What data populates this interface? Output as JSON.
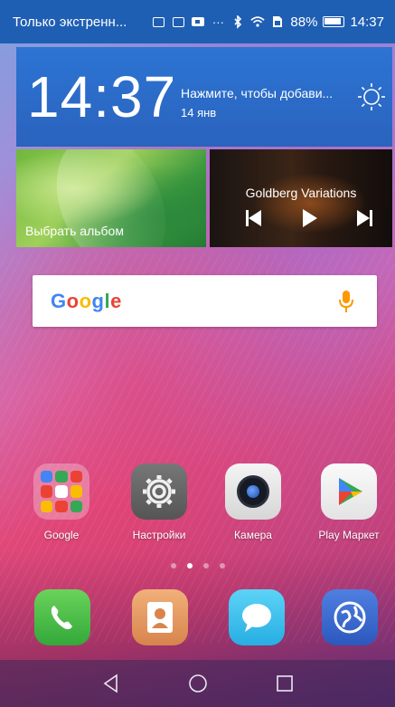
{
  "status_bar": {
    "carrier": "Только экстренн...",
    "battery_percent": "88%",
    "time": "14:37",
    "icons": [
      "message-icon",
      "image-icon",
      "video-icon",
      "more-dots-icon",
      "bluetooth-icon",
      "wifi-icon",
      "sim-icon",
      "battery-icon"
    ]
  },
  "clock_widget": {
    "time": "14:37",
    "hint": "Нажмите, чтобы добави...",
    "date": "14 янв",
    "weather_icon": "sun-icon"
  },
  "album_widget": {
    "label": "Выбрать альбом"
  },
  "music_widget": {
    "title": "Goldberg Variations",
    "controls": [
      "previous-icon",
      "play-icon",
      "next-icon"
    ]
  },
  "search": {
    "logo": [
      "G",
      "o",
      "o",
      "g",
      "l",
      "e"
    ],
    "mic_icon": "microphone-icon"
  },
  "apps": [
    {
      "label": "Google",
      "icon": "folder-icon"
    },
    {
      "label": "Настройки",
      "icon": "gear-icon"
    },
    {
      "label": "Камера",
      "icon": "camera-icon"
    },
    {
      "label": "Play Маркет",
      "icon": "play-store-icon"
    }
  ],
  "pages": {
    "count": 4,
    "active": 1
  },
  "dock": [
    "phone-icon",
    "contacts-icon",
    "messages-icon",
    "browser-icon"
  ],
  "nav": [
    "back-icon",
    "home-icon",
    "recents-icon"
  ],
  "colors": {
    "status_bar": "#1f5fb3",
    "clock_widget": "#2a6ccb",
    "google_blue": "#4285f4",
    "google_red": "#ea4335",
    "google_yellow": "#fbbc05",
    "google_green": "#34a853",
    "mic": "#ff9800"
  }
}
